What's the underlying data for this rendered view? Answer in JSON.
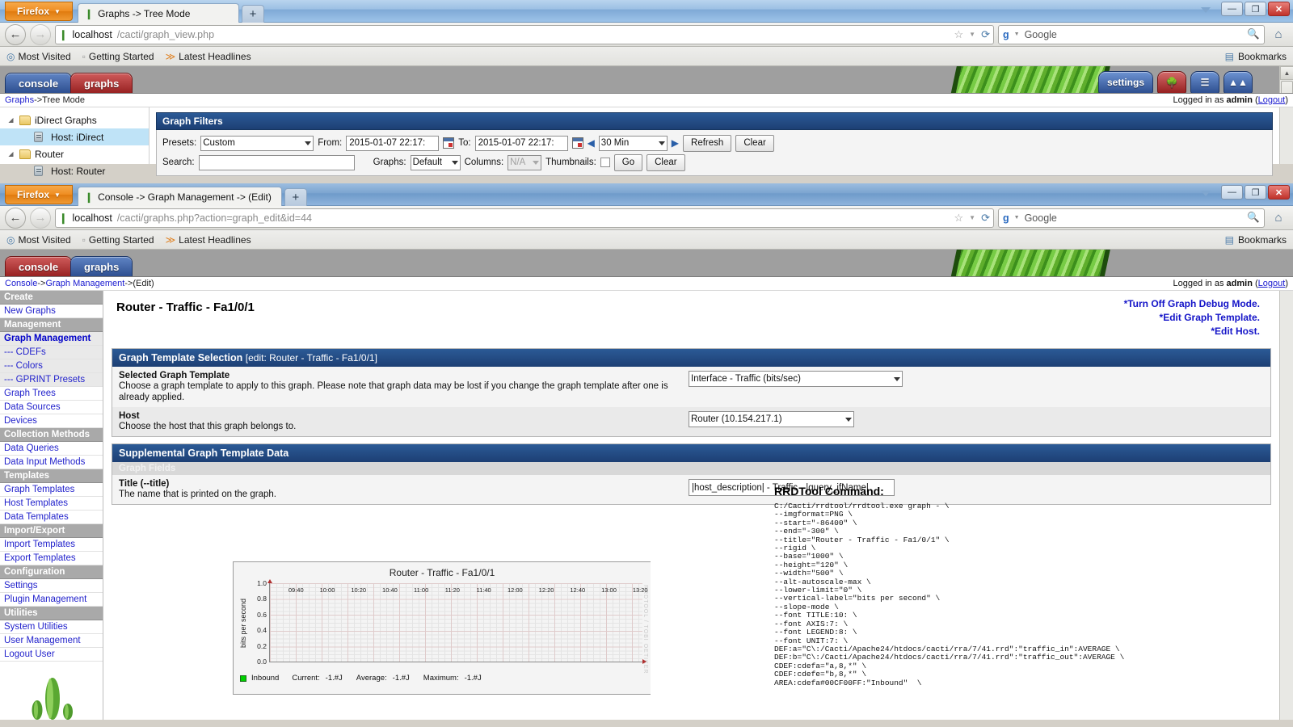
{
  "window1": {
    "firefox_button": "Firefox",
    "tab_title": "Graphs -> Tree Mode",
    "new_tab": "+",
    "url_host": "localhost",
    "url_path": "/cacti/graph_view.php",
    "search_placeholder": "Google",
    "bookmarks": [
      "Most Visited",
      "Getting Started",
      "Latest Headlines"
    ],
    "bookmarks_label": "Bookmarks",
    "nav_tabs": [
      {
        "label": "console",
        "color": "blue"
      },
      {
        "label": "graphs",
        "color": "red"
      }
    ],
    "header_buttons": [
      "settings"
    ],
    "breadcrumb_link": "Graphs",
    "breadcrumb_sep": " -> ",
    "breadcrumb_current": "Tree Mode",
    "logged_in_prefix": "Logged in as ",
    "logged_in_user": "admin",
    "logout": "Logout",
    "tree": [
      {
        "label": "iDirect Graphs",
        "type": "folder",
        "selected": false
      },
      {
        "label": "Host: iDirect",
        "type": "host",
        "selected": true
      },
      {
        "label": "Router",
        "type": "folder",
        "selected": false
      },
      {
        "label": "Host: Router",
        "type": "host",
        "selected": false
      }
    ],
    "filters": {
      "title": "Graph Filters",
      "presets_label": "Presets:",
      "presets_value": "Custom",
      "from_label": "From:",
      "from_value": "2015-01-07 22:17:",
      "to_label": "To:",
      "to_value": "2015-01-07 22:17:",
      "interval_value": "30 Min",
      "refresh_label": "Refresh",
      "clear_label": "Clear",
      "search_label": "Search:",
      "search_value": "",
      "graphs_label": "Graphs:",
      "graphs_value": "Default",
      "columns_label": "Columns:",
      "columns_value": "N/A",
      "thumbnails_label": "Thumbnails:",
      "go_label": "Go",
      "clear2_label": "Clear"
    }
  },
  "window2": {
    "firefox_button": "Firefox",
    "tab_title": "Console -> Graph Management -> (Edit)",
    "new_tab": "+",
    "url_host": "localhost",
    "url_path": "/cacti/graphs.php?action=graph_edit&id=44",
    "search_placeholder": "Google",
    "bookmarks": [
      "Most Visited",
      "Getting Started",
      "Latest Headlines"
    ],
    "bookmarks_label": "Bookmarks",
    "nav_tabs": [
      {
        "label": "console",
        "color": "red"
      },
      {
        "label": "graphs",
        "color": "blue"
      }
    ],
    "breadcrumb": "Console -> Graph Management -> (Edit)",
    "breadcrumb_parts": [
      "Console",
      " -> ",
      "Graph Management",
      " -> ",
      "(Edit)"
    ],
    "logged_in_prefix": "Logged in as ",
    "logged_in_user": "admin",
    "logout": "Logout",
    "sidebar": [
      {
        "label": "Create",
        "type": "head"
      },
      {
        "label": "New Graphs",
        "type": "item"
      },
      {
        "label": "Management",
        "type": "head"
      },
      {
        "label": "Graph Management",
        "type": "active"
      },
      {
        "label": "--- CDEFs",
        "type": "sub"
      },
      {
        "label": "--- Colors",
        "type": "sub"
      },
      {
        "label": "--- GPRINT Presets",
        "type": "sub"
      },
      {
        "label": "Graph Trees",
        "type": "item"
      },
      {
        "label": "Data Sources",
        "type": "item"
      },
      {
        "label": "Devices",
        "type": "item"
      },
      {
        "label": "Collection Methods",
        "type": "head"
      },
      {
        "label": "Data Queries",
        "type": "item"
      },
      {
        "label": "Data Input Methods",
        "type": "item"
      },
      {
        "label": "Templates",
        "type": "head"
      },
      {
        "label": "Graph Templates",
        "type": "item"
      },
      {
        "label": "Host Templates",
        "type": "item"
      },
      {
        "label": "Data Templates",
        "type": "item"
      },
      {
        "label": "Import/Export",
        "type": "head"
      },
      {
        "label": "Import Templates",
        "type": "item"
      },
      {
        "label": "Export Templates",
        "type": "item"
      },
      {
        "label": "Configuration",
        "type": "head"
      },
      {
        "label": "Settings",
        "type": "item"
      },
      {
        "label": "Plugin Management",
        "type": "item"
      },
      {
        "label": "Utilities",
        "type": "head"
      },
      {
        "label": "System Utilities",
        "type": "item"
      },
      {
        "label": "User Management",
        "type": "item"
      },
      {
        "label": "Logout User",
        "type": "item"
      }
    ],
    "page_title": "Router - Traffic - Fa1/0/1",
    "debug_links": [
      "*Turn Off Graph Debug Mode.",
      "*Edit Graph Template.",
      "*Edit Host."
    ],
    "section1": {
      "title": "Graph Template Selection",
      "subtitle": "[edit: Router - Traffic - Fa1/0/1]",
      "rows": [
        {
          "name": "Selected Graph Template",
          "desc": "Choose a graph template to apply to this graph. Please note that graph data may be lost if you change the graph template after one is already applied.",
          "value": "Interface - Traffic (bits/sec)"
        },
        {
          "name": "Host",
          "desc": "Choose the host that this graph belongs to.",
          "value": "Router (10.154.217.1)"
        }
      ]
    },
    "section2": {
      "title": "Supplemental Graph Template Data",
      "subhead": "Graph Fields",
      "rows": [
        {
          "name": "Title (--title)",
          "desc": "The name that is printed on the graph.",
          "value": "|host_description| - Traffic - |query_ifName|"
        }
      ]
    },
    "rrdtool": {
      "title": "RRDTool Command:",
      "command": "C:/Cacti/rrdtool/rrdtool.exe graph - \\\n--imgformat=PNG \\\n--start=\"-86400\" \\\n--end=\"-300\" \\\n--title=\"Router - Traffic - Fa1/0/1\" \\\n--rigid \\\n--base=\"1000\" \\\n--height=\"120\" \\\n--width=\"500\" \\\n--alt-autoscale-max \\\n--lower-limit=\"0\" \\\n--vertical-label=\"bits per second\" \\\n--slope-mode \\\n--font TITLE:10: \\\n--font AXIS:7: \\\n--font LEGEND:8: \\\n--font UNIT:7: \\\nDEF:a=\"C\\:/Cacti/Apache24/htdocs/cacti/rra/7/41.rrd\":\"traffic_in\":AVERAGE \\\nDEF:b=\"C\\:/Cacti/Apache24/htdocs/cacti/rra/7/41.rrd\":\"traffic_out\":AVERAGE \\\nCDEF:cdefa=\"a,8,*\" \\\nCDEF:cdefe=\"b,8,*\" \\\nAREA:cdefa#00CF00FF:\"Inbound\"  \\"
    }
  },
  "chart_data": {
    "type": "line",
    "title": "Router - Traffic - Fa1/0/1",
    "ylabel": "bits per second",
    "xlabel": "",
    "ylim": [
      0,
      1.0
    ],
    "yticks": [
      "0.0",
      "0.2",
      "0.4",
      "0.6",
      "0.8",
      "1.0"
    ],
    "xticks": [
      "09:40",
      "10:00",
      "10:20",
      "10:40",
      "11:00",
      "11:20",
      "11:40",
      "12:00",
      "12:20",
      "12:40",
      "13:00",
      "13:20"
    ],
    "grid": true,
    "series": [
      {
        "name": "Inbound",
        "color": "#00CF00",
        "values": []
      }
    ],
    "legend": {
      "name": "Inbound",
      "current_label": "Current:",
      "current_value": "-1.#J",
      "average_label": "Average:",
      "average_value": "-1.#J",
      "maximum_label": "Maximum:",
      "maximum_value": "-1.#J"
    },
    "watermark": "RRDTOOL / TOBI OETIKER"
  }
}
